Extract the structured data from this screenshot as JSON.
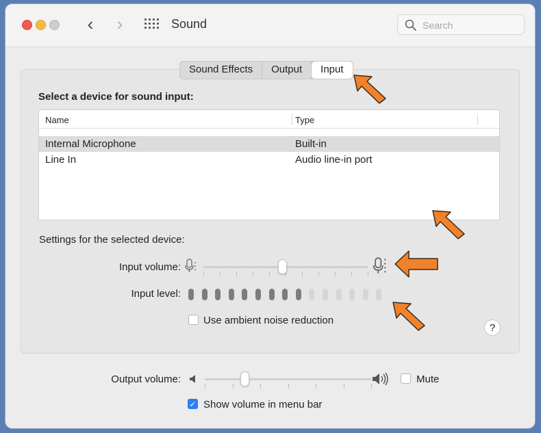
{
  "window": {
    "title": "Sound"
  },
  "search": {
    "placeholder": "Search"
  },
  "tabs": [
    {
      "label": "Sound Effects"
    },
    {
      "label": "Output"
    },
    {
      "label": "Input",
      "active": true
    }
  ],
  "input": {
    "heading": "Select a device for sound input:",
    "columns": [
      "Name",
      "Type"
    ],
    "devices": [
      {
        "name": "Internal Microphone",
        "type": "Built-in",
        "selected": true
      },
      {
        "name": "Line In",
        "type": "Audio line-in port",
        "selected": false
      }
    ],
    "settings_label": "Settings for the selected device:",
    "input_volume_label": "Input volume:",
    "input_volume_fraction": 0.48,
    "input_level_label": "Input level:",
    "input_level_active_bars": 9,
    "input_level_total_bars": 15,
    "ambient_noise_label": "Use ambient noise reduction",
    "ambient_noise_checked": false,
    "help_label": "?"
  },
  "output": {
    "volume_label": "Output volume:",
    "volume_fraction": 0.24,
    "mute_label": "Mute",
    "mute_checked": false,
    "show_in_menu_bar_label": "Show volume in menu bar",
    "show_in_menu_bar_checked": true
  },
  "colors": {
    "accent": "#2f7cf6",
    "highlight_arrow": "#f0822c",
    "level_active": "#7d7d7d",
    "level_inactive": "#d6d6d6"
  },
  "icons": [
    "back-chevron-icon",
    "forward-chevron-icon",
    "grid-icon",
    "search-icon",
    "microphone-icon",
    "speaker-low-icon",
    "speaker-high-icon",
    "arrow-pointer-icon"
  ]
}
